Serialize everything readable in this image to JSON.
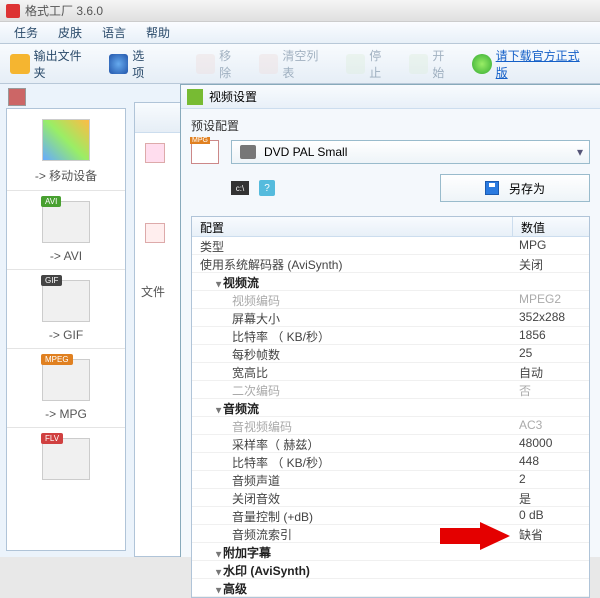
{
  "window": {
    "title": "格式工厂 3.6.0"
  },
  "menu": [
    "任务",
    "皮肤",
    "语言",
    "帮助"
  ],
  "toolbar": {
    "output": "输出文件夹",
    "options": "选项",
    "remove": "移除",
    "clear": "清空列表",
    "stop": "停止",
    "start": "开始",
    "download": "请下载官方正式版"
  },
  "sidebar": {
    "items": [
      {
        "label": "-> 移动设备",
        "badge": ""
      },
      {
        "label": "-> AVI",
        "badge": "AVI",
        "cls": ""
      },
      {
        "label": "-> GIF",
        "badge": "GIF",
        "cls": "gif"
      },
      {
        "label": "-> MPG",
        "badge": "MPEG",
        "cls": "mpg"
      },
      {
        "label": "",
        "badge": "FLV",
        "cls": "flv"
      }
    ]
  },
  "panel2": {
    "file_label": "文件"
  },
  "settings": {
    "title": "视频设置",
    "preset_label": "预设配置",
    "preset_value": "DVD PAL Small",
    "save_as": "另存为",
    "grid_header_key": "配置",
    "grid_header_val": "数值",
    "rows": [
      {
        "k": "类型",
        "v": "MPG",
        "ind": 0
      },
      {
        "k": "使用系统解码器 (AviSynth)",
        "v": "关闭",
        "ind": 0
      },
      {
        "k": "视频流",
        "v": "",
        "ind": 1,
        "section": true
      },
      {
        "k": "视频编码",
        "v": "MPEG2",
        "ind": 2,
        "dim": true
      },
      {
        "k": "屏幕大小",
        "v": "352x288",
        "ind": 2
      },
      {
        "k": "比特率 （ KB/秒）",
        "v": "1856",
        "ind": 2
      },
      {
        "k": "每秒帧数",
        "v": "25",
        "ind": 2
      },
      {
        "k": "宽高比",
        "v": "自动",
        "ind": 2
      },
      {
        "k": "二次编码",
        "v": "否",
        "ind": 2,
        "dim": true
      },
      {
        "k": "音频流",
        "v": "",
        "ind": 1,
        "section": true
      },
      {
        "k": "音视频编码",
        "v": "AC3",
        "ind": 2,
        "dim": true
      },
      {
        "k": "采样率（ 赫兹）",
        "v": "48000",
        "ind": 2
      },
      {
        "k": "比特率 （ KB/秒）",
        "v": "448",
        "ind": 2
      },
      {
        "k": "音频声道",
        "v": "2",
        "ind": 2
      },
      {
        "k": "关闭音效",
        "v": "是",
        "ind": 2
      },
      {
        "k": "音量控制 (+dB)",
        "v": "0 dB",
        "ind": 2
      },
      {
        "k": "音频流索引",
        "v": "缺省",
        "ind": 2
      },
      {
        "k": "附加字幕",
        "v": "",
        "ind": 1,
        "section": true
      },
      {
        "k": "水印 (AviSynth)",
        "v": "",
        "ind": 1,
        "section": true
      },
      {
        "k": "高级",
        "v": "",
        "ind": 1,
        "section": true
      }
    ]
  }
}
